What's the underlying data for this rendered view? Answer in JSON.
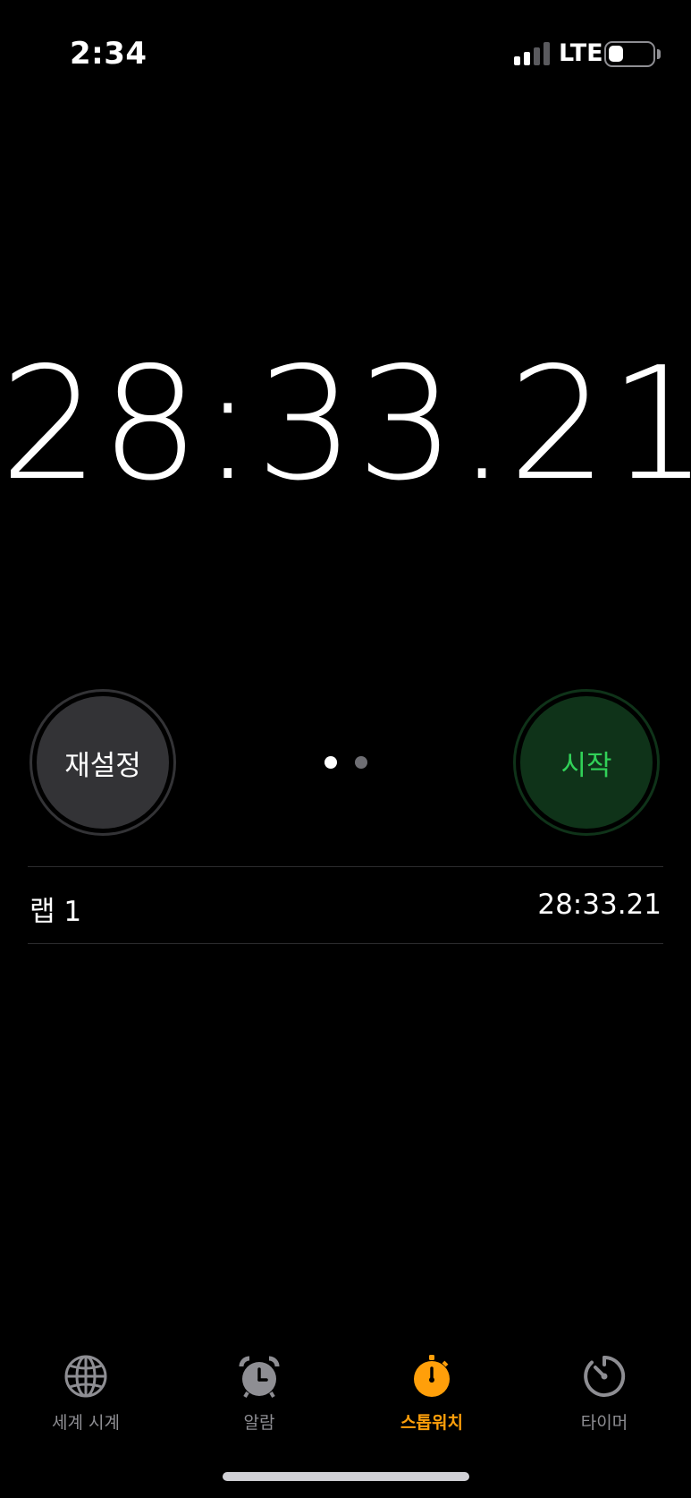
{
  "status_bar": {
    "time": "2:34",
    "network": "LTE",
    "signal_bars_active": 2,
    "signal_bars_total": 4,
    "battery_level": 0.35
  },
  "stopwatch": {
    "elapsed": "28:33.21",
    "reset_label": "재설정",
    "start_label": "시작",
    "page_count": 2,
    "current_page": 0
  },
  "laps": [
    {
      "label": "랩 1",
      "time": "28:33.21"
    }
  ],
  "tabs": [
    {
      "label": "세계 시계",
      "icon": "globe-icon",
      "active": false
    },
    {
      "label": "알람",
      "icon": "alarm-clock-icon",
      "active": false
    },
    {
      "label": "스톱워치",
      "icon": "stopwatch-icon",
      "active": true
    },
    {
      "label": "타이머",
      "icon": "timer-icon",
      "active": false
    }
  ],
  "colors": {
    "background": "#000000",
    "accent_orange": "#ff9f0a",
    "start_green": "#31d158",
    "start_bg": "#0f3319",
    "reset_bg": "#333336",
    "inactive_gray": "#8e8e93"
  }
}
